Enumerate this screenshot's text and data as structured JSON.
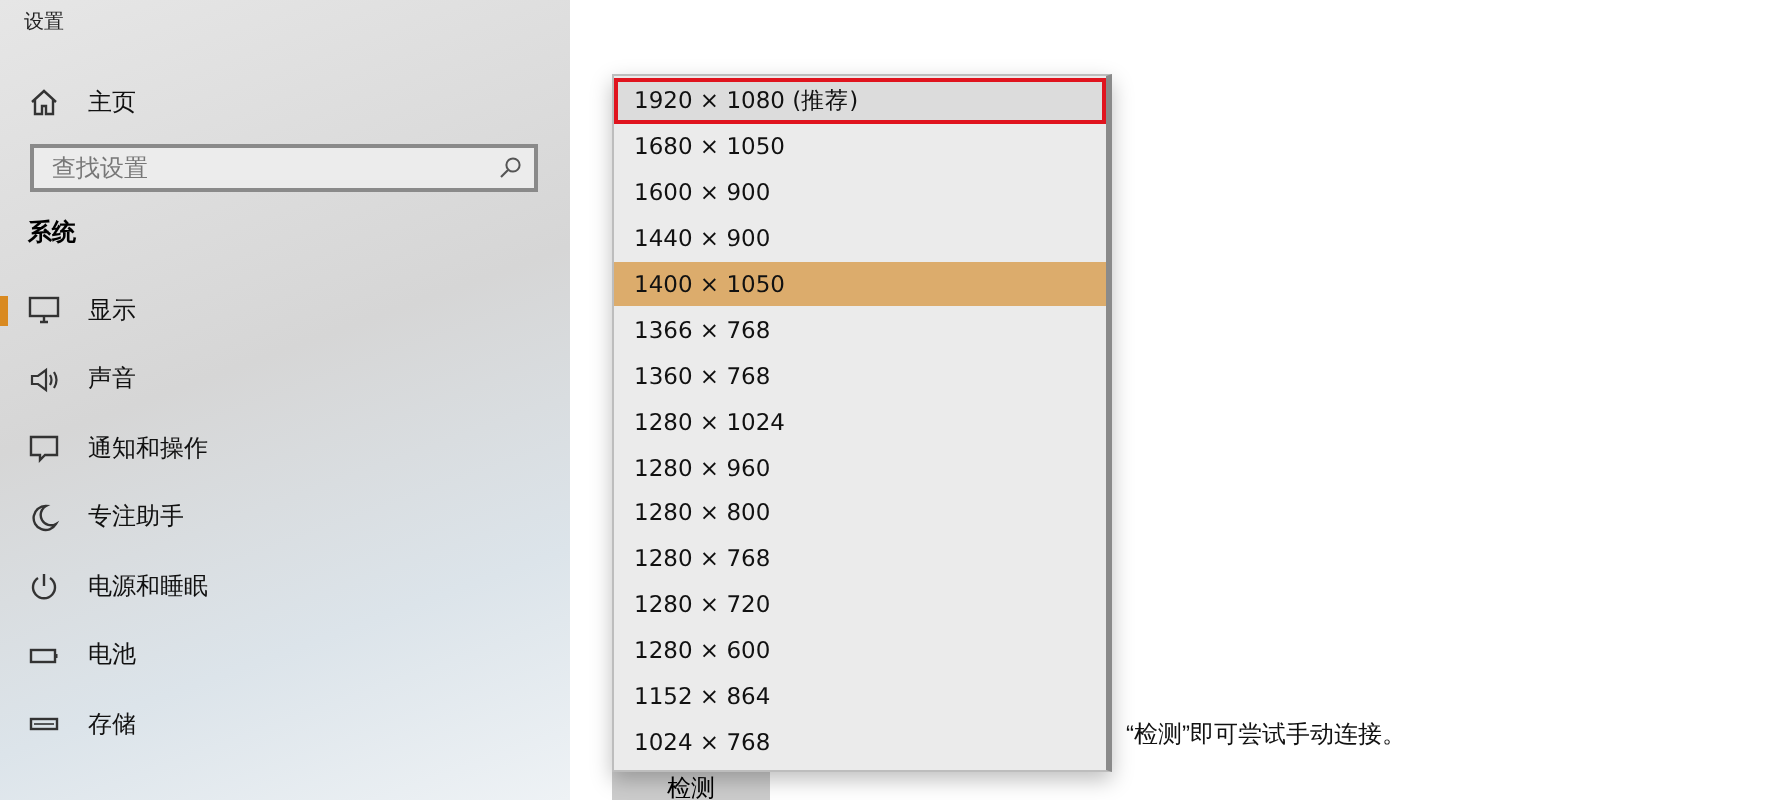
{
  "window": {
    "title": "设置"
  },
  "home": {
    "label": "主页"
  },
  "search": {
    "placeholder": "查找设置"
  },
  "section": {
    "title": "系统"
  },
  "sidebar": {
    "items": [
      {
        "label": "显示",
        "kind": "display",
        "selected": true
      },
      {
        "label": "声音",
        "kind": "sound",
        "selected": false
      },
      {
        "label": "通知和操作",
        "kind": "notifications",
        "selected": false
      },
      {
        "label": "专注助手",
        "kind": "focus",
        "selected": false
      },
      {
        "label": "电源和睡眠",
        "kind": "power",
        "selected": false
      },
      {
        "label": "电池",
        "kind": "battery",
        "selected": false
      },
      {
        "label": "存储",
        "kind": "storage",
        "selected": false
      }
    ]
  },
  "main": {
    "hint": "“检测”即可尝试手动连接。",
    "detect_button": "检测"
  },
  "dropdown": {
    "options": [
      {
        "label": "1920 × 1080 (推荐)",
        "selected": false,
        "outlined": true
      },
      {
        "label": "1680 × 1050",
        "selected": false,
        "outlined": false
      },
      {
        "label": "1600 × 900",
        "selected": false,
        "outlined": false
      },
      {
        "label": "1440 × 900",
        "selected": false,
        "outlined": false
      },
      {
        "label": "1400 × 1050",
        "selected": true,
        "outlined": false
      },
      {
        "label": "1366 × 768",
        "selected": false,
        "outlined": false
      },
      {
        "label": "1360 × 768",
        "selected": false,
        "outlined": false
      },
      {
        "label": "1280 × 1024",
        "selected": false,
        "outlined": false
      },
      {
        "label": "1280 × 960",
        "selected": false,
        "outlined": false
      },
      {
        "label": "1280 × 800",
        "selected": false,
        "outlined": false
      },
      {
        "label": "1280 × 768",
        "selected": false,
        "outlined": false
      },
      {
        "label": "1280 × 720",
        "selected": false,
        "outlined": false
      },
      {
        "label": "1280 × 600",
        "selected": false,
        "outlined": false
      },
      {
        "label": "1152 × 864",
        "selected": false,
        "outlined": false
      },
      {
        "label": "1024 × 768",
        "selected": false,
        "outlined": false
      }
    ]
  }
}
